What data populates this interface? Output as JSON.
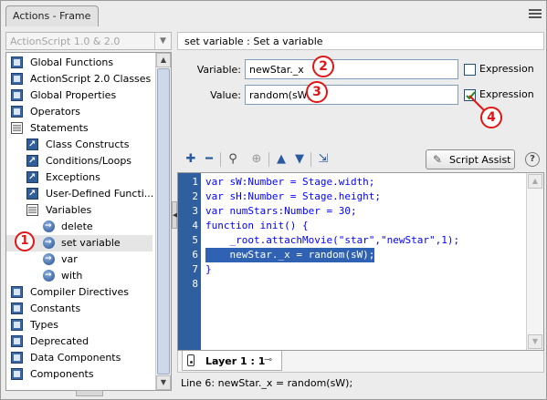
{
  "window": {
    "title": "Actions - Frame"
  },
  "left_panel": {
    "version_selector": {
      "value": "ActionScript 1.0 & 2.0"
    },
    "tree": [
      {
        "label": "Global Functions",
        "type": "book"
      },
      {
        "label": "ActionScript 2.0 Classes",
        "type": "book"
      },
      {
        "label": "Global Properties",
        "type": "book"
      },
      {
        "label": "Operators",
        "type": "book"
      },
      {
        "label": "Statements",
        "type": "book-open"
      },
      {
        "label": "Class Constructs",
        "type": "book"
      },
      {
        "label": "Conditions/Loops",
        "type": "book"
      },
      {
        "label": "Exceptions",
        "type": "book"
      },
      {
        "label": "User-Defined Functi...",
        "type": "book"
      },
      {
        "label": "Variables",
        "type": "book-open"
      },
      {
        "label": "delete",
        "type": "item"
      },
      {
        "label": "set variable",
        "type": "item"
      },
      {
        "label": "var",
        "type": "item"
      },
      {
        "label": "with",
        "type": "item"
      },
      {
        "label": "Compiler Directives",
        "type": "book"
      },
      {
        "label": "Constants",
        "type": "book"
      },
      {
        "label": "Types",
        "type": "book"
      },
      {
        "label": "Deprecated",
        "type": "book"
      },
      {
        "label": "Data Components",
        "type": "book"
      },
      {
        "label": "Components",
        "type": "book"
      }
    ]
  },
  "right_panel": {
    "description": "set variable : Set a variable",
    "variable": {
      "label": "Variable:",
      "value": "newStar._x",
      "expression_label": "Expression",
      "expression_checked": false
    },
    "value_field": {
      "label": "Value:",
      "value": "random(sW)",
      "expression_label": "Expression",
      "expression_checked": true
    },
    "script_assist_label": "Script Assist",
    "callouts": [
      "1",
      "2",
      "3",
      "4"
    ],
    "code_lines": [
      {
        "num": "1",
        "text": "var sW:Number = Stage.width;"
      },
      {
        "num": "2",
        "text": "var sH:Number = Stage.height;"
      },
      {
        "num": "3",
        "text": "var numStars:Number = 30;"
      },
      {
        "num": "4",
        "text": "function init() {"
      },
      {
        "num": "5",
        "text": "    _root.attachMovie(\"star\",\"newStar\",1);"
      },
      {
        "num": "6",
        "text": "    newStar._x = random(sW);"
      },
      {
        "num": "7",
        "text": "}"
      },
      {
        "num": "8",
        "text": ""
      }
    ],
    "layer_tab": "Layer 1 : 1",
    "status": "Line 6: newStar._x = random(sW);"
  },
  "colors": {
    "gutter": "#2f5f9f",
    "code": "#0000ff",
    "highlight": "#2f62b3",
    "callout": "#e01616"
  }
}
